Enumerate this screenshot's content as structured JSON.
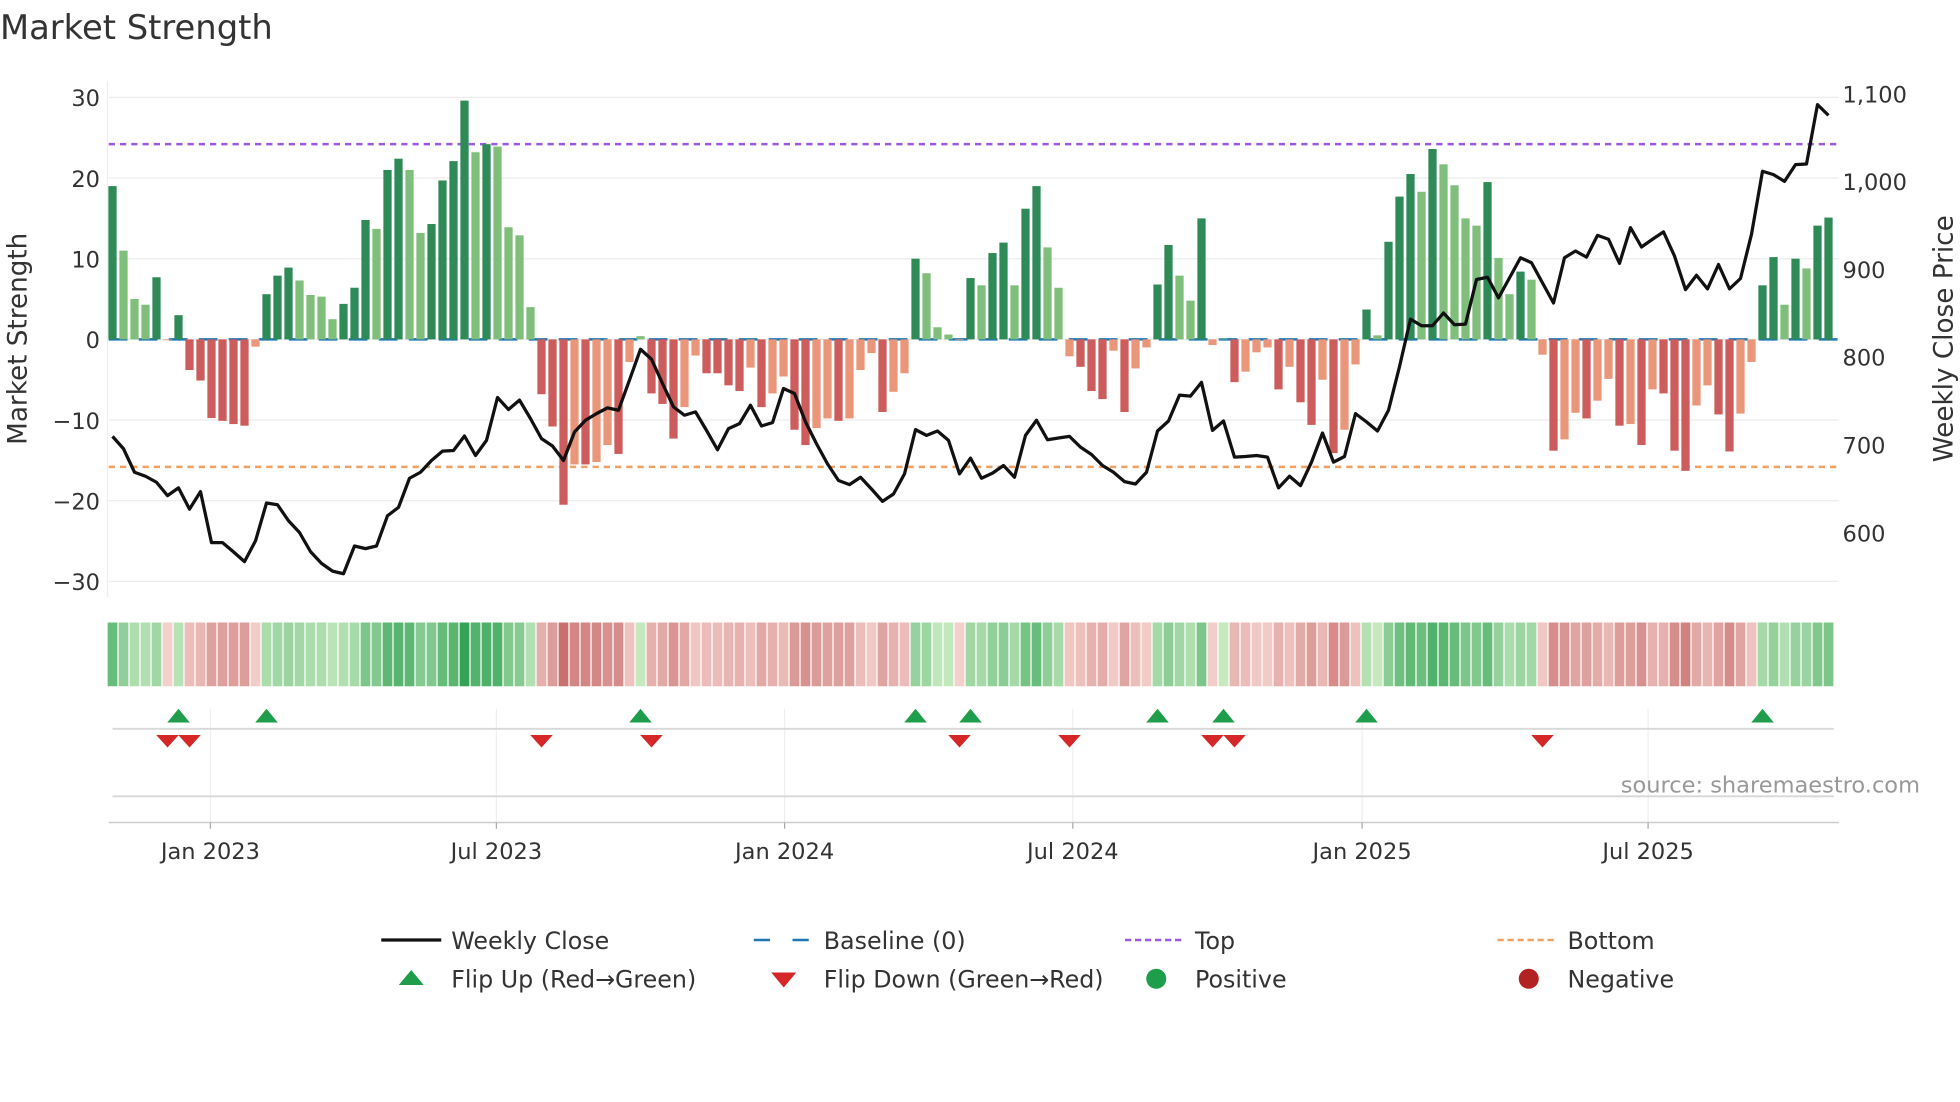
{
  "chart_data": {
    "type": "bar+line",
    "title": "Market Strength",
    "ylabel": "Market Strength",
    "y2label": "Weekly Close Price",
    "ylim": [
      -32,
      32
    ],
    "y2lim": [
      526,
      1114
    ],
    "yticks": [
      30,
      20,
      10,
      0,
      -10,
      -20,
      -30
    ],
    "yticklabels": [
      "30",
      "20",
      "10",
      "0",
      "−10",
      "−20",
      "−30"
    ],
    "y2ticks": [
      600,
      700,
      800,
      900,
      1000,
      1100
    ],
    "y2ticklabels": [
      "600",
      "700",
      "800",
      "900",
      "1,000",
      "1,100"
    ],
    "xticks": [
      {
        "week": 9.9,
        "label": "Jan 2023"
      },
      {
        "week": 35.9,
        "label": "Jul 2023"
      },
      {
        "week": 62.1,
        "label": "Jan 2024"
      },
      {
        "week": 88.3,
        "label": "Jul 2024"
      },
      {
        "week": 114.6,
        "label": "Jan 2025"
      },
      {
        "week": 140.6,
        "label": "Jul 2025"
      }
    ],
    "top_level": 24.2,
    "bottom_level": -15.8,
    "baseline": 0,
    "strength": [
      19.0,
      11.0,
      5.0,
      4.3,
      7.7,
      -0.1,
      3.0,
      -3.8,
      -5.1,
      -9.75,
      -10.1,
      -10.5,
      -10.7,
      -0.9,
      5.6,
      7.9,
      8.9,
      7.3,
      5.5,
      5.3,
      2.5,
      4.4,
      6.4,
      14.8,
      13.7,
      21.0,
      22.4,
      21.0,
      13.2,
      14.3,
      19.7,
      22.1,
      29.6,
      23.2,
      24.2,
      23.9,
      13.9,
      12.9,
      4.0,
      -6.8,
      -10.8,
      -20.5,
      -15.5,
      -15.5,
      -15.2,
      -13.1,
      -14.2,
      -2.8,
      0.4,
      -6.7,
      -8.0,
      -12.3,
      -8.4,
      -2.0,
      -4.2,
      -4.2,
      -5.7,
      -6.4,
      -3.5,
      -8.4,
      -6.7,
      -4.6,
      -11.2,
      -13.1,
      -11.0,
      -9.8,
      -10.1,
      -9.8,
      -3.8,
      -1.7,
      -9.0,
      -6.5,
      -4.2,
      10.0,
      8.2,
      1.5,
      0.6,
      -0.1,
      7.6,
      6.7,
      10.7,
      12.0,
      6.7,
      16.2,
      19.0,
      11.4,
      6.4,
      -2.1,
      -3.4,
      -6.4,
      -7.4,
      -1.4,
      -9.0,
      -3.6,
      -1.0,
      6.8,
      11.7,
      7.9,
      4.8,
      15.0,
      -0.7,
      0.1,
      -5.3,
      -4.0,
      -1.6,
      -1.0,
      -6.2,
      -3.4,
      -7.8,
      -10.6,
      -5.0,
      -14.1,
      -11.2,
      -3.1,
      3.7,
      0.5,
      12.1,
      17.7,
      20.5,
      18.3,
      23.6,
      21.7,
      19.1,
      15.0,
      14.1,
      19.5,
      10.1,
      5.6,
      8.4,
      7.4,
      -1.9,
      -13.8,
      -12.4,
      -9.1,
      -9.8,
      -7.6,
      -4.9,
      -10.7,
      -10.5,
      -13.1,
      -6.2,
      -6.7,
      -13.8,
      -16.3,
      -8.2,
      -5.7,
      -9.3,
      -13.9,
      -9.2,
      -2.8,
      6.7,
      10.2,
      4.3,
      10.0,
      8.8,
      14.1,
      15.1
    ],
    "close": [
      709.5,
      695.4,
      668.7,
      664.1,
      657.3,
      642,
      650.8,
      626.7,
      646.6,
      588.5,
      588.5,
      577.9,
      566.8,
      590.5,
      633.6,
      631.7,
      613.4,
      600,
      578.2,
      564.9,
      556.1,
      553.1,
      584.7,
      581.7,
      584.7,
      619.1,
      628.6,
      661.8,
      668.7,
      682.1,
      692.7,
      693.5,
      709.9,
      687.8,
      705,
      753.8,
      740.1,
      750.8,
      729.8,
      706.9,
      698.5,
      682.1,
      714.5,
      727.9,
      735.5,
      742,
      739.3,
      773.7,
      808.8,
      797.3,
      769.8,
      743.1,
      733.6,
      737.4,
      716.4,
      694.3,
      718.3,
      724,
      745,
      721.4,
      725.2,
      764.1,
      758.4,
      726,
      701.1,
      678.2,
      659.2,
      654.6,
      663,
      649.6,
      635.5,
      643.9,
      666.8,
      717.2,
      710.7,
      715.6,
      705,
      666.8,
      684.7,
      661.8,
      667.6,
      676.3,
      663,
      710.7,
      727.9,
      705.7,
      707.6,
      709.5,
      697.3,
      688.9,
      676.3,
      668.7,
      658,
      655.3,
      668.7,
      715.6,
      727.1,
      756.5,
      755.3,
      771,
      716.4,
      727.1,
      685.9,
      686.6,
      687.8,
      685.9,
      650.8,
      664.1,
      653.4,
      680.2,
      713.4,
      680.2,
      686.6,
      735.5,
      726,
      715.6,
      739.3,
      788.9,
      843.1,
      835.5,
      835.5,
      850,
      836.6,
      837.4,
      888.2,
      890.8,
      867.2,
      890.1,
      913,
      907.3,
      884.4,
      861.5,
      913,
      920.6,
      913.7,
      938.5,
      934,
      906.5,
      947.3,
      925.2,
      934,
      942.4,
      914.9,
      876.7,
      893.1,
      877.5,
      905.3,
      877.5,
      889.3,
      939.7,
      1011.5,
      1007.6,
      1000,
      1019.1,
      1019.8,
      1087.4,
      1075.2
    ],
    "colors": {
      "pos_strong": "#2e8b57",
      "pos_weak": "#7fbf7b",
      "neg_strong": "#cd5c5c",
      "neg_weak": "#e9967a",
      "close": "#111111",
      "baseline": "#1f77b4",
      "top": "#9b59e0",
      "bottom": "#f0a060",
      "flip_up": "#1e9e4a",
      "flip_down": "#d62728",
      "positive": "#1e9e4a",
      "negative": "#b22222"
    },
    "legend": {
      "placement": "bottom",
      "items": [
        {
          "label": "Weekly Close",
          "kind": "line"
        },
        {
          "label": "Baseline (0)",
          "kind": "dash-blue"
        },
        {
          "label": "Top",
          "kind": "dot-purple"
        },
        {
          "label": "Bottom",
          "kind": "dot-orange"
        },
        {
          "label": "Flip Up (Red→Green)",
          "kind": "tri-up"
        },
        {
          "label": "Flip Down (Green→Red)",
          "kind": "tri-down"
        },
        {
          "label": "Positive",
          "kind": "circle-green"
        },
        {
          "label": "Negative",
          "kind": "circle-red"
        }
      ]
    },
    "source": "source: sharemaestro.com"
  }
}
